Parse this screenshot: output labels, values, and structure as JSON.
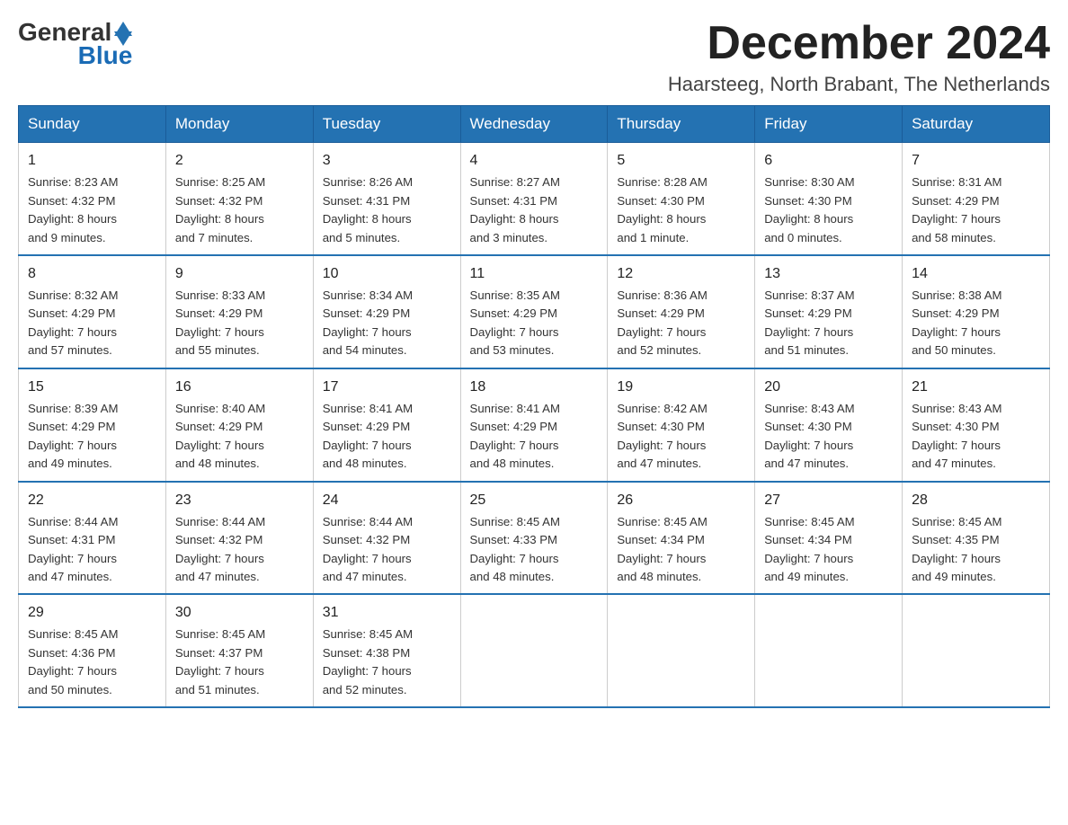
{
  "logo": {
    "text_general": "General",
    "text_blue": "Blue"
  },
  "header": {
    "month_year": "December 2024",
    "location": "Haarsteeg, North Brabant, The Netherlands"
  },
  "weekdays": [
    "Sunday",
    "Monday",
    "Tuesday",
    "Wednesday",
    "Thursday",
    "Friday",
    "Saturday"
  ],
  "weeks": [
    [
      {
        "day": "1",
        "info": "Sunrise: 8:23 AM\nSunset: 4:32 PM\nDaylight: 8 hours\nand 9 minutes."
      },
      {
        "day": "2",
        "info": "Sunrise: 8:25 AM\nSunset: 4:32 PM\nDaylight: 8 hours\nand 7 minutes."
      },
      {
        "day": "3",
        "info": "Sunrise: 8:26 AM\nSunset: 4:31 PM\nDaylight: 8 hours\nand 5 minutes."
      },
      {
        "day": "4",
        "info": "Sunrise: 8:27 AM\nSunset: 4:31 PM\nDaylight: 8 hours\nand 3 minutes."
      },
      {
        "day": "5",
        "info": "Sunrise: 8:28 AM\nSunset: 4:30 PM\nDaylight: 8 hours\nand 1 minute."
      },
      {
        "day": "6",
        "info": "Sunrise: 8:30 AM\nSunset: 4:30 PM\nDaylight: 8 hours\nand 0 minutes."
      },
      {
        "day": "7",
        "info": "Sunrise: 8:31 AM\nSunset: 4:29 PM\nDaylight: 7 hours\nand 58 minutes."
      }
    ],
    [
      {
        "day": "8",
        "info": "Sunrise: 8:32 AM\nSunset: 4:29 PM\nDaylight: 7 hours\nand 57 minutes."
      },
      {
        "day": "9",
        "info": "Sunrise: 8:33 AM\nSunset: 4:29 PM\nDaylight: 7 hours\nand 55 minutes."
      },
      {
        "day": "10",
        "info": "Sunrise: 8:34 AM\nSunset: 4:29 PM\nDaylight: 7 hours\nand 54 minutes."
      },
      {
        "day": "11",
        "info": "Sunrise: 8:35 AM\nSunset: 4:29 PM\nDaylight: 7 hours\nand 53 minutes."
      },
      {
        "day": "12",
        "info": "Sunrise: 8:36 AM\nSunset: 4:29 PM\nDaylight: 7 hours\nand 52 minutes."
      },
      {
        "day": "13",
        "info": "Sunrise: 8:37 AM\nSunset: 4:29 PM\nDaylight: 7 hours\nand 51 minutes."
      },
      {
        "day": "14",
        "info": "Sunrise: 8:38 AM\nSunset: 4:29 PM\nDaylight: 7 hours\nand 50 minutes."
      }
    ],
    [
      {
        "day": "15",
        "info": "Sunrise: 8:39 AM\nSunset: 4:29 PM\nDaylight: 7 hours\nand 49 minutes."
      },
      {
        "day": "16",
        "info": "Sunrise: 8:40 AM\nSunset: 4:29 PM\nDaylight: 7 hours\nand 48 minutes."
      },
      {
        "day": "17",
        "info": "Sunrise: 8:41 AM\nSunset: 4:29 PM\nDaylight: 7 hours\nand 48 minutes."
      },
      {
        "day": "18",
        "info": "Sunrise: 8:41 AM\nSunset: 4:29 PM\nDaylight: 7 hours\nand 48 minutes."
      },
      {
        "day": "19",
        "info": "Sunrise: 8:42 AM\nSunset: 4:30 PM\nDaylight: 7 hours\nand 47 minutes."
      },
      {
        "day": "20",
        "info": "Sunrise: 8:43 AM\nSunset: 4:30 PM\nDaylight: 7 hours\nand 47 minutes."
      },
      {
        "day": "21",
        "info": "Sunrise: 8:43 AM\nSunset: 4:30 PM\nDaylight: 7 hours\nand 47 minutes."
      }
    ],
    [
      {
        "day": "22",
        "info": "Sunrise: 8:44 AM\nSunset: 4:31 PM\nDaylight: 7 hours\nand 47 minutes."
      },
      {
        "day": "23",
        "info": "Sunrise: 8:44 AM\nSunset: 4:32 PM\nDaylight: 7 hours\nand 47 minutes."
      },
      {
        "day": "24",
        "info": "Sunrise: 8:44 AM\nSunset: 4:32 PM\nDaylight: 7 hours\nand 47 minutes."
      },
      {
        "day": "25",
        "info": "Sunrise: 8:45 AM\nSunset: 4:33 PM\nDaylight: 7 hours\nand 48 minutes."
      },
      {
        "day": "26",
        "info": "Sunrise: 8:45 AM\nSunset: 4:34 PM\nDaylight: 7 hours\nand 48 minutes."
      },
      {
        "day": "27",
        "info": "Sunrise: 8:45 AM\nSunset: 4:34 PM\nDaylight: 7 hours\nand 49 minutes."
      },
      {
        "day": "28",
        "info": "Sunrise: 8:45 AM\nSunset: 4:35 PM\nDaylight: 7 hours\nand 49 minutes."
      }
    ],
    [
      {
        "day": "29",
        "info": "Sunrise: 8:45 AM\nSunset: 4:36 PM\nDaylight: 7 hours\nand 50 minutes."
      },
      {
        "day": "30",
        "info": "Sunrise: 8:45 AM\nSunset: 4:37 PM\nDaylight: 7 hours\nand 51 minutes."
      },
      {
        "day": "31",
        "info": "Sunrise: 8:45 AM\nSunset: 4:38 PM\nDaylight: 7 hours\nand 52 minutes."
      },
      null,
      null,
      null,
      null
    ]
  ]
}
